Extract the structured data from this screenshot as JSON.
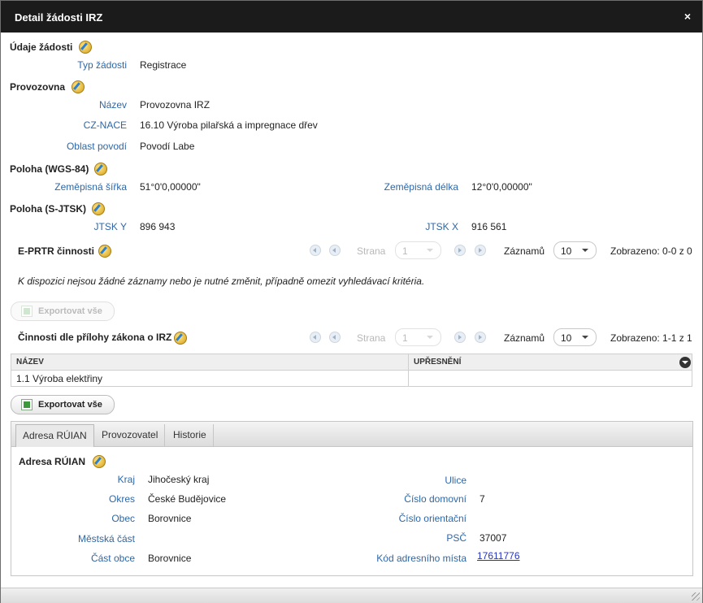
{
  "dialog": {
    "title": "Detail žádosti IRZ",
    "close": "×"
  },
  "udaje": {
    "heading": "Údaje žádosti",
    "typ_label": "Typ žádosti",
    "typ_value": "Registrace"
  },
  "provozovna": {
    "heading": "Provozovna",
    "nazev_label": "Název",
    "nazev_value": "Provozovna IRZ",
    "nace_label": "CZ-NACE",
    "nace_value": "16.10 Výroba pilařská a impregnace dřev",
    "oblast_label": "Oblast povodí",
    "oblast_value": "Povodí Labe"
  },
  "wgs": {
    "heading": "Poloha (WGS-84)",
    "sirka_label": "Zeměpisná šířka",
    "sirka_value": "51°0'0,00000\"",
    "delka_label": "Zeměpisná délka",
    "delka_value": "12°0'0,00000\""
  },
  "sjtsk": {
    "heading": "Poloha (S-JTSK)",
    "y_label": "JTSK Y",
    "y_value": "896 943",
    "x_label": "JTSK X",
    "x_value": "916 561"
  },
  "eprtr": {
    "heading": "E-PRTR činnosti",
    "strana_label": "Strana",
    "strana_value": "1",
    "zaznamu_label": "Záznamů",
    "zaznamu_value": "10",
    "zobrazeno": "Zobrazeno: 0-0 z 0",
    "empty_msg": "K dispozici nejsou žádné záznamy nebo je nutné změnit, případně omezit vyhledávací kritéria.",
    "export_label": "Exportovat vše"
  },
  "cinnosti": {
    "heading": "Činnosti dle přílohy zákona o IRZ",
    "strana_label": "Strana",
    "strana_value": "1",
    "zaznamu_label": "Záznamů",
    "zaznamu_value": "10",
    "zobrazeno": "Zobrazeno: 1-1 z 1",
    "columns": [
      "NÁZEV",
      "UPŘESNĚNÍ"
    ],
    "rows": [
      [
        "1.1 Výroba elektřiny",
        ""
      ]
    ],
    "export_label": "Exportovat vše"
  },
  "tabs": [
    "Adresa RÚIAN",
    "Provozovatel",
    "Historie"
  ],
  "adresa": {
    "heading": "Adresa RÚIAN",
    "kraj_label": "Kraj",
    "kraj_value": "Jihočeský kraj",
    "okres_label": "Okres",
    "okres_value": "České Budějovice",
    "obec_label": "Obec",
    "obec_value": "Borovnice",
    "mestska_label": "Městská část",
    "mestska_value": "",
    "cast_label": "Část obce",
    "cast_value": "Borovnice",
    "ulice_label": "Ulice",
    "ulice_value": "",
    "domovni_label": "Číslo domovní",
    "domovni_value": "7",
    "orientacni_label": "Číslo orientační",
    "orientacni_value": "",
    "psc_label": "PSČ",
    "psc_value": "37007",
    "kod_label": "Kód adresního místa",
    "kod_value": "17611776"
  }
}
